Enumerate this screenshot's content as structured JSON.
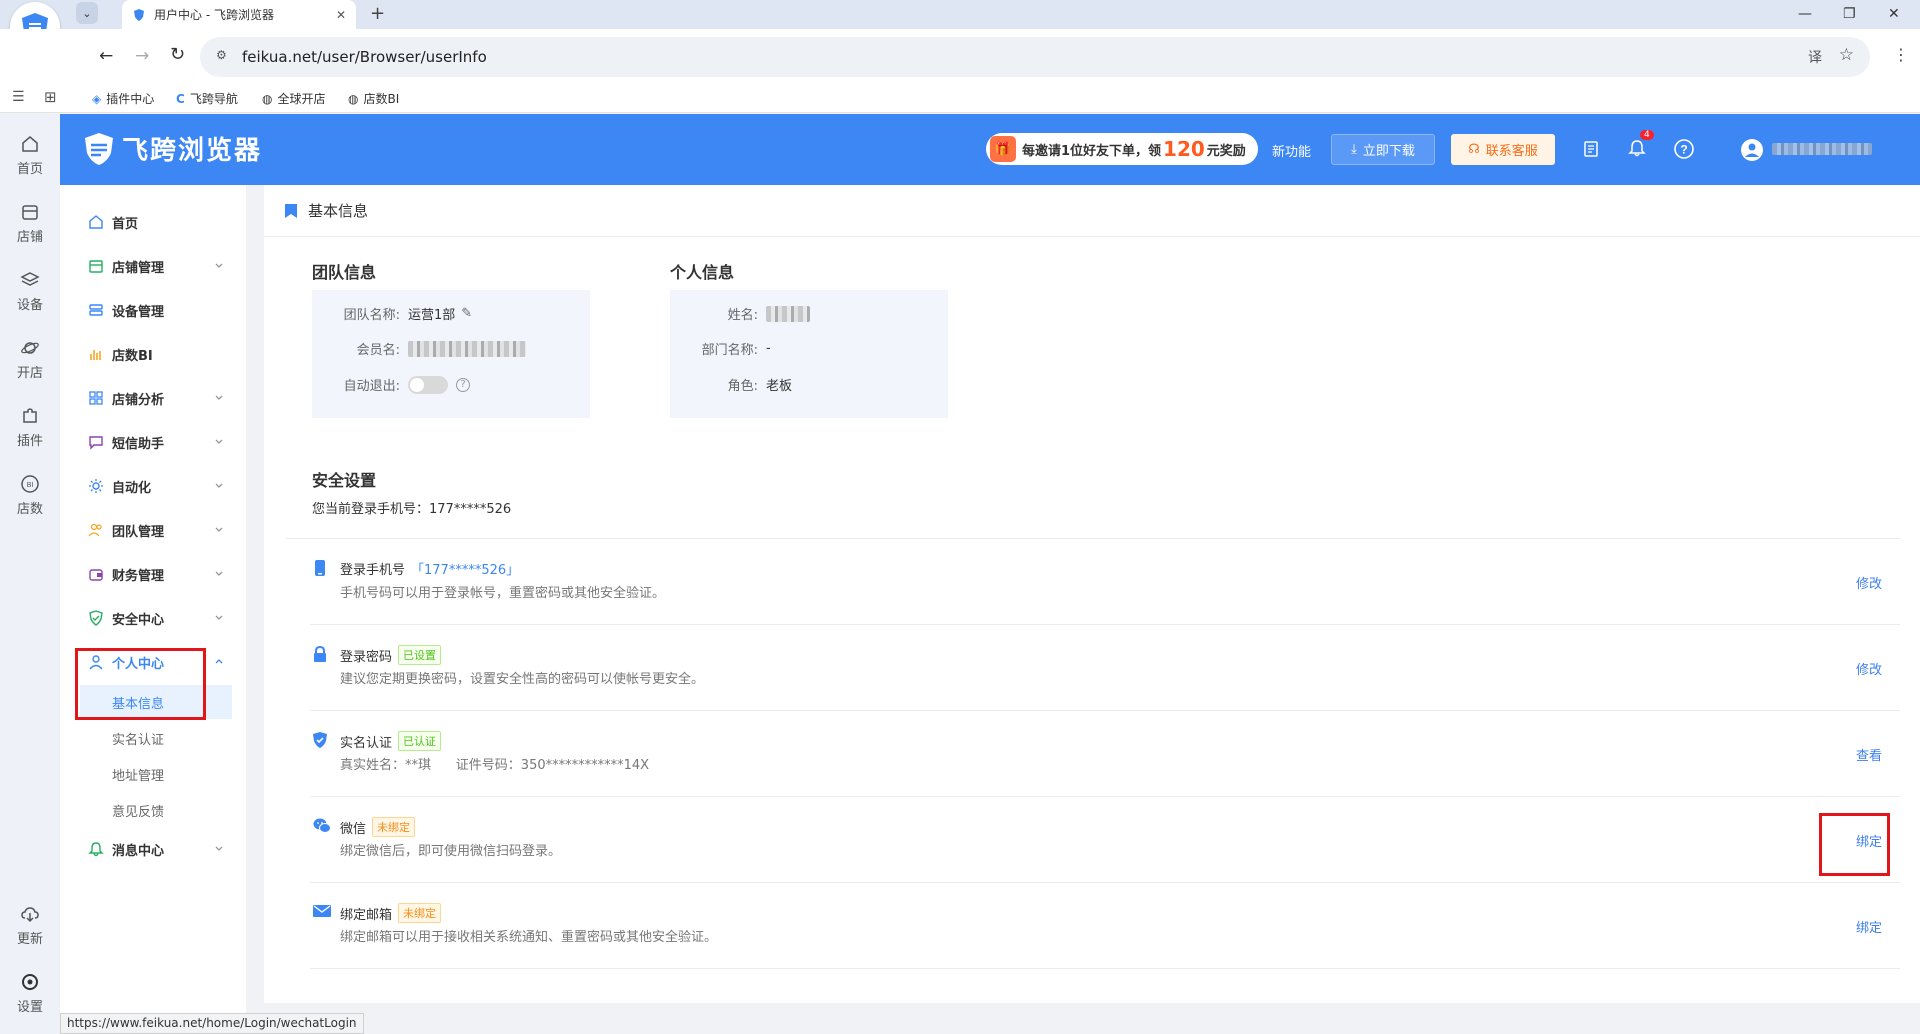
{
  "browser": {
    "tab_title": "用户中心 - 飞跨浏览器",
    "new_tab": "+",
    "url": "feikua.net/user/Browser/userInfo",
    "bookmarks": [
      "插件中心",
      "飞跨导航",
      "全球开店",
      "店数BI"
    ],
    "win_min": "—",
    "win_max": "❐",
    "win_close": "✕",
    "status_url": "https://www.feikua.net/home/Login/wechatLogin"
  },
  "header": {
    "logo_text": "飞跨浏览器",
    "promo_prefix": "每邀请1位好友下单，领",
    "promo_amount": "120",
    "promo_suffix": "元奖励",
    "new_features": "新功能",
    "download": "立即下载",
    "contact": "联系客服",
    "notify_count": "4"
  },
  "rail": {
    "items": [
      "首页",
      "店铺",
      "设备",
      "开店",
      "插件",
      "店数"
    ],
    "update": "更新",
    "settings": "设置"
  },
  "sidebar": {
    "items": [
      {
        "label": "首页"
      },
      {
        "label": "店铺管理"
      },
      {
        "label": "设备管理"
      },
      {
        "label": "店数BI"
      },
      {
        "label": "店铺分析"
      },
      {
        "label": "短信助手"
      },
      {
        "label": "自动化"
      },
      {
        "label": "团队管理"
      },
      {
        "label": "财务管理"
      },
      {
        "label": "安全中心"
      },
      {
        "label": "个人中心"
      },
      {
        "label": "消息中心"
      }
    ],
    "sub_items": [
      "基本信息",
      "实名认证",
      "地址管理",
      "意见反馈"
    ]
  },
  "page": {
    "title": "基本信息",
    "team": {
      "heading": "团队信息",
      "name_label": "团队名称:",
      "name_value": "运营1部",
      "member_label": "会员名:",
      "auto_logout_label": "自动退出:"
    },
    "personal": {
      "heading": "个人信息",
      "name_label": "姓名:",
      "dept_label": "部门名称:",
      "dept_value": "-",
      "role_label": "角色:",
      "role_value": "老板"
    },
    "security": {
      "heading": "安全设置",
      "current_phone": "您当前登录手机号：177*****526",
      "rows": [
        {
          "title": "登录手机号",
          "extra": "「177*****526」",
          "desc": "手机号码可以用于登录帐号，重置密码或其他安全验证。",
          "action": "修改"
        },
        {
          "title": "登录密码",
          "tag": "已设置",
          "desc": "建议您定期更换密码，设置安全性高的密码可以使帐号更安全。",
          "action": "修改"
        },
        {
          "title": "实名认证",
          "tag": "已认证",
          "desc": "真实姓名：**琪      证件号码：350************14X",
          "action": "查看"
        },
        {
          "title": "微信",
          "tag": "未绑定",
          "desc": "绑定微信后，即可使用微信扫码登录。",
          "action": "绑定"
        },
        {
          "title": "绑定邮箱",
          "tag": "未绑定",
          "desc": "绑定邮箱可以用于接收相关系统通知、重置密码或其他安全验证。",
          "action": "绑定"
        }
      ]
    }
  },
  "colors": {
    "brand": "#3d87f5",
    "link": "#3d7ff0",
    "highlight": "#e0161b"
  }
}
